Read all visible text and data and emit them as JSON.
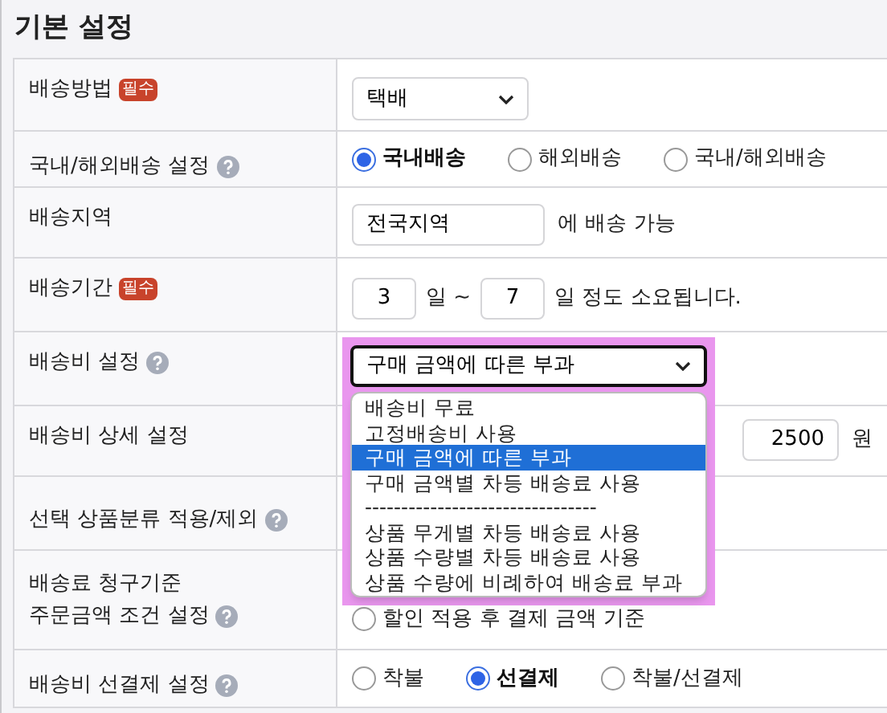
{
  "title": "기본 설정",
  "rows": [
    {
      "label": [
        "배송방법"
      ],
      "badge": "필수",
      "help": false,
      "kind": "select",
      "value": "택배"
    },
    {
      "label": [
        "국내/해외배송 설정"
      ],
      "help": true,
      "kind": "radios",
      "options": [
        {
          "label": "국내배송",
          "selected": true
        },
        {
          "label": "해외배송",
          "selected": false
        },
        {
          "label": "국내/해외배송",
          "selected": false
        }
      ]
    },
    {
      "label": [
        "배송지역"
      ],
      "help": false,
      "kind": "region",
      "value": "전국지역",
      "suffix": "에 배송 가능"
    },
    {
      "label": [
        "배송기간"
      ],
      "badge": "필수",
      "help": false,
      "kind": "period",
      "from": "3",
      "mid": "일 ~",
      "to": "7",
      "suffix": "일 정도 소요됩니다."
    },
    {
      "label": [
        "배송비 설정"
      ],
      "help": true,
      "kind": "dropdown",
      "value": "구매 금액에 따른 부과",
      "options": [
        {
          "label": "배송비 무료",
          "selected": false
        },
        {
          "label": "고정배송비 사용",
          "selected": false
        },
        {
          "label": "구매 금액에 따른 부과",
          "selected": true
        },
        {
          "label": "구매 금액별 차등 배송료 사용",
          "selected": false
        },
        {
          "label": "--------------------------------",
          "selected": false
        },
        {
          "label": "상품 무게별 차등 배송료 사용",
          "selected": false
        },
        {
          "label": "상품 수량별 차등 배송료 사용",
          "selected": false
        },
        {
          "label": "상품 수량에 비례하여 배송료 부과",
          "selected": false
        }
      ]
    },
    {
      "label": [
        "배송비 상세 설정"
      ],
      "help": false,
      "kind": "amount",
      "value": "2500",
      "suffix": "원"
    },
    {
      "label": [
        "선택 상품분류 적용/제외"
      ],
      "help": true,
      "kind": "empty"
    },
    {
      "label": [
        "배송료 청구기준",
        "주문금액 조건 설정"
      ],
      "help": true,
      "kind": "radio_stack",
      "options": [
        {
          "label": "할인 적용 후 결제 금액 기준",
          "selected": false
        }
      ]
    },
    {
      "label": [
        "배송비 선결제 설정"
      ],
      "help": true,
      "kind": "radios",
      "options": [
        {
          "label": "착불",
          "selected": false
        },
        {
          "label": "선결제",
          "selected": true
        },
        {
          "label": "착불/선결제",
          "selected": false
        }
      ]
    }
  ]
}
